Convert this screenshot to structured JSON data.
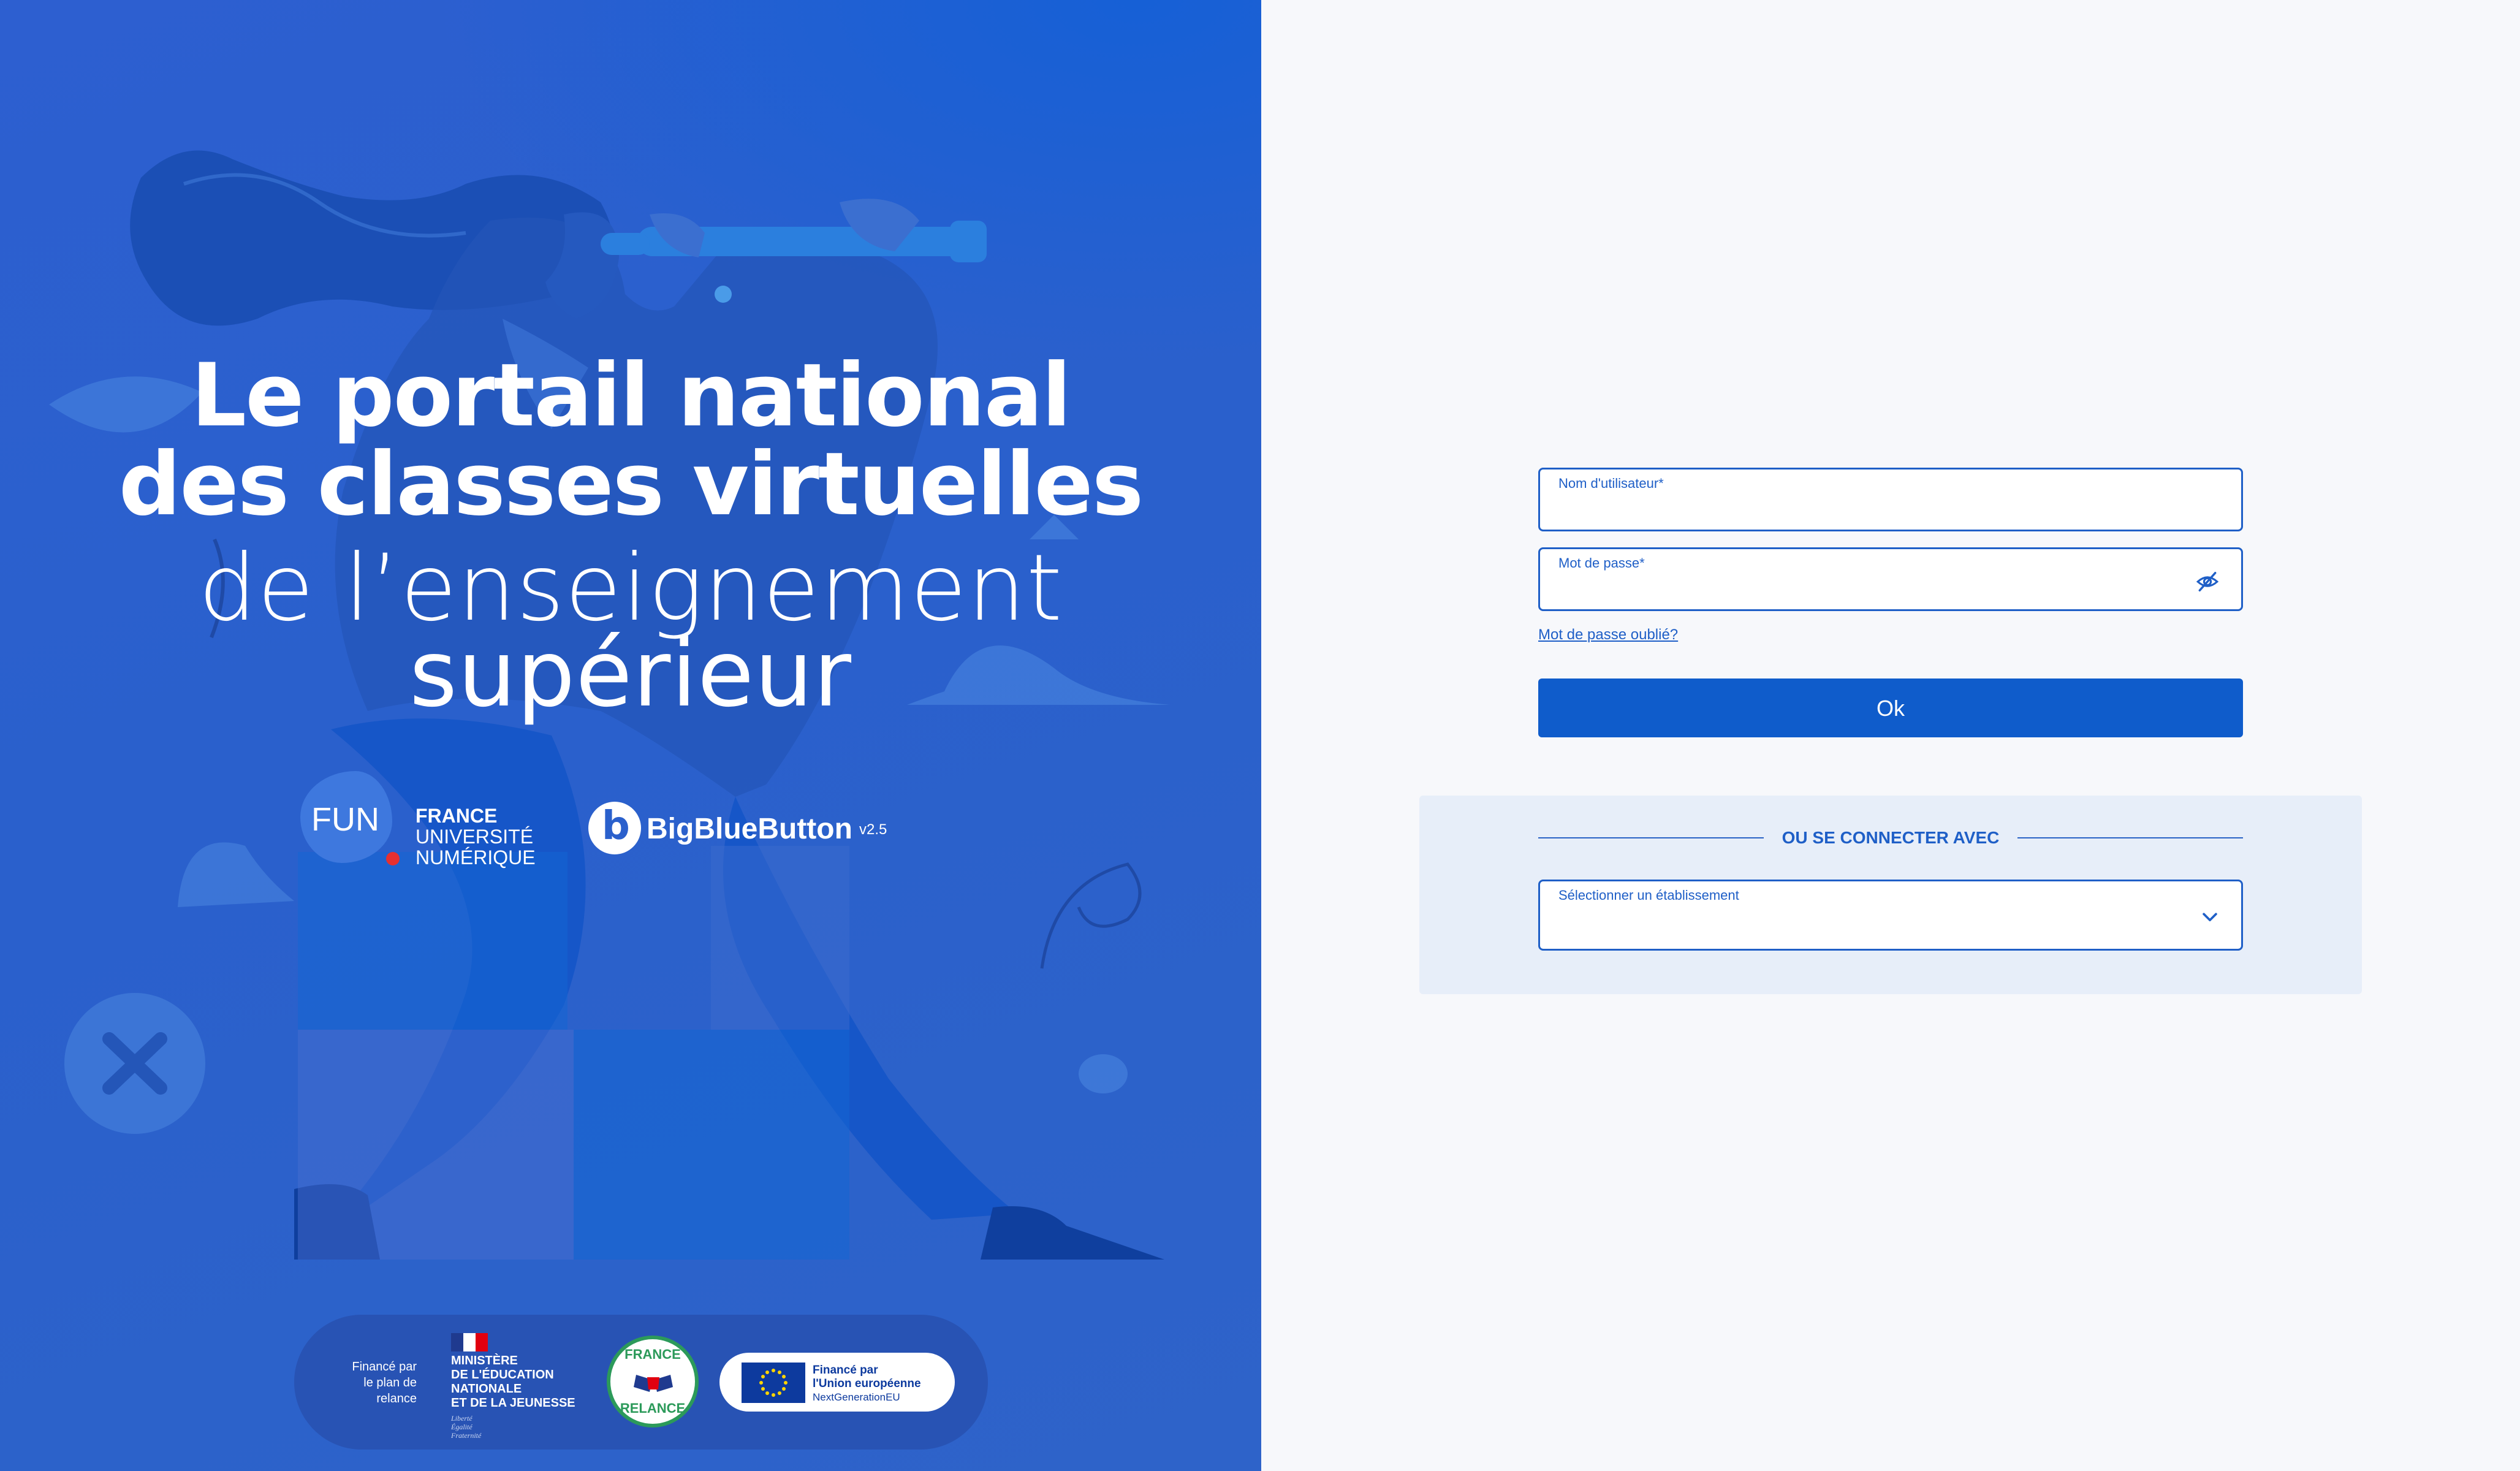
{
  "hero": {
    "title_line1": "Le portail national",
    "title_line2": "des classes virtuelles",
    "title_line3": "de l’enseignement",
    "title_line4": "supérieur",
    "fun_mark": "FUN",
    "fun_name": [
      "FRANCE",
      "UNIVERSITÉ",
      "NUMÉRIQUE"
    ],
    "bbb_name": "BigBlueButton",
    "bbb_version": "v2.5",
    "funding_label": "Financé par le plan de relance",
    "ministry": [
      "MINISTÈRE",
      "DE L'ÉDUCATION",
      "NATIONALE",
      "ET DE LA JEUNESSE"
    ],
    "motto": [
      "Liberté",
      "Égalité",
      "Fraternité"
    ],
    "relance_top": "FRANCE",
    "relance_bottom": "RELANCE",
    "eu_line1": "Financé par",
    "eu_line2": "l'Union européenne",
    "eu_line3": "NextGenerationEU"
  },
  "login": {
    "username_label": "Nom d'utilisateur*",
    "username_value": "",
    "password_label": "Mot de passe*",
    "password_value": "",
    "forgot_label": "Mot de passe oublié?",
    "ok_label": "Ok",
    "sso_title": "OU SE CONNECTER AVEC",
    "select_label": "Sélectionner un établissement",
    "select_value": ""
  },
  "colors": {
    "hero_bg": "#2a60cc",
    "accent": "#0f5ccb",
    "field_border": "#1f5fc7",
    "sso_bg": "#e7eef9",
    "page_bg": "#f7f8fb"
  },
  "icons": {
    "password_toggle": "eye-slash-icon",
    "select_chevron": "chevron-down-icon",
    "close": "close-icon"
  }
}
